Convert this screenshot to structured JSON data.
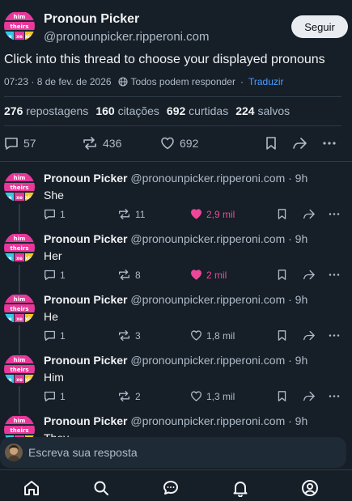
{
  "main_post": {
    "author_name": "Pronoun Picker",
    "author_handle": "@pronounpicker.ripperoni.com",
    "follow_label": "Seguir",
    "text": "Click into this thread to choose your displayed pronouns",
    "timestamp": "07:23 · 8 de fev. de 2026",
    "reply_setting": "Todos podem responder",
    "translate_label": "Traduzir",
    "stats": {
      "reposts_count": "276",
      "reposts_label": "repostagens",
      "quotes_count": "160",
      "quotes_label": "citações",
      "likes_count": "692",
      "likes_label": "curtidas",
      "saves_count": "224",
      "saves_label": "salvos"
    },
    "actions": {
      "replies": "57",
      "reposts": "436",
      "likes": "692"
    }
  },
  "replies": [
    {
      "author_name": "Pronoun Picker",
      "handle_time": "@pronounpicker.ripperoni.com · 9h",
      "text": "She",
      "replies": "1",
      "reposts": "11",
      "likes": "2,9 mil",
      "liked": true
    },
    {
      "author_name": "Pronoun Picker",
      "handle_time": "@pronounpicker.ripperoni.com · 9h",
      "text": "Her",
      "replies": "1",
      "reposts": "8",
      "likes": "2 mil",
      "liked": true
    },
    {
      "author_name": "Pronoun Picker",
      "handle_time": "@pronounpicker.ripperoni.com · 9h",
      "text": "He",
      "replies": "1",
      "reposts": "3",
      "likes": "1,8 mil",
      "liked": false
    },
    {
      "author_name": "Pronoun Picker",
      "handle_time": "@pronounpicker.ripperoni.com · 9h",
      "text": "Him",
      "replies": "1",
      "reposts": "2",
      "likes": "1,3 mil",
      "liked": false
    },
    {
      "author_name": "Pronoun Picker",
      "handle_time": "@pronounpicker.ripperoni.com · 9h",
      "text": "They",
      "replies": "",
      "reposts": "",
      "likes": "",
      "liked": false
    }
  ],
  "composer": {
    "placeholder": "Escreva sua resposta"
  },
  "avatar_badge_words": [
    "him",
    "theirs",
    "re",
    "xe",
    "xim"
  ],
  "colors": {
    "background": "#161e27",
    "accent_link": "#4a9eff",
    "like_active": "#ec4899",
    "avatar_pink": "#e8389a",
    "avatar_cyan": "#39c6e8",
    "avatar_yellow": "#f4c623"
  },
  "nav_icons": [
    "home-icon",
    "search-icon",
    "chat-icon",
    "bell-icon",
    "profile-icon"
  ]
}
